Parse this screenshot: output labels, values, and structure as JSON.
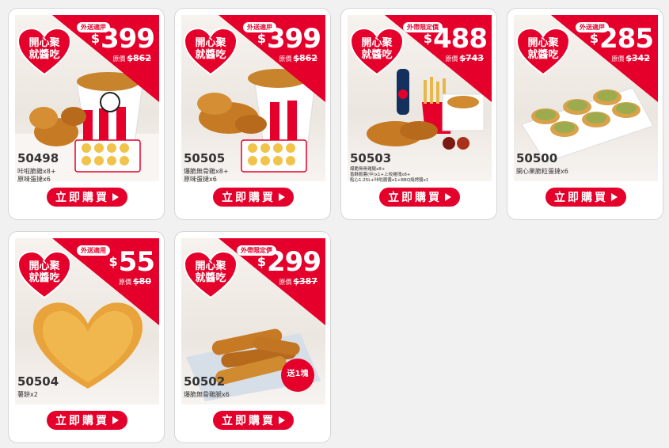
{
  "colors": {
    "brand_red": "#e4002b",
    "card_bg": "#ffffff",
    "page_bg": "#f1f1f1"
  },
  "promo_heart_text": "開心聚就醬吃",
  "buy_label": "立即購買",
  "products": [
    {
      "code": "50498",
      "tag": "外送適用",
      "currency": "$",
      "price": "399",
      "orig_label": "原價",
      "orig_price": "$862",
      "desc": [
        "咔啦脆雞x8+",
        "原味蛋撻x6"
      ]
    },
    {
      "code": "50505",
      "tag": "外送適用",
      "currency": "$",
      "price": "399",
      "orig_label": "原價",
      "orig_price": "$862",
      "desc": [
        "爆脆無骨雞x8+",
        "原味蛋撻x6"
      ]
    },
    {
      "code": "50503",
      "tag": "外帶限定價",
      "currency": "$",
      "price": "488",
      "orig_label": "原價",
      "orig_price": "$743",
      "desc": [
        "爆脆無骨雞腿x8+",
        "香酥脆薯(中)x1+上校雞塊x8+",
        "點心1.25L+咔啦醬醬x1+BBQ燒烤醬x1"
      ]
    },
    {
      "code": "50500",
      "tag": "外送適用",
      "currency": "$",
      "price": "285",
      "orig_label": "原價",
      "orig_price": "$342",
      "desc": [
        "開心果脆粒蛋撻x6"
      ]
    },
    {
      "code": "50504",
      "tag": "外送適用",
      "currency": "$",
      "price": "55",
      "orig_label": "原價",
      "orig_price": "$80",
      "desc": [
        "薯餅x2"
      ]
    },
    {
      "code": "50502",
      "tag": "外帶限定價",
      "currency": "$",
      "price": "299",
      "orig_label": "原價",
      "orig_price": "$387",
      "desc": [
        "爆脆無骨雞腿x6"
      ],
      "badge": "送1塊"
    }
  ]
}
